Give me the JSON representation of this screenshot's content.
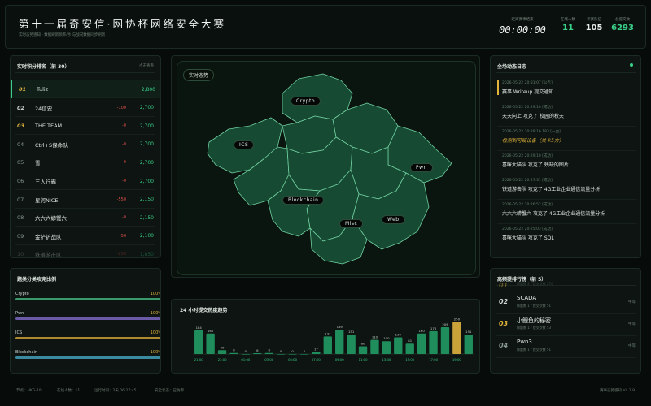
{
  "header": {
    "title": "第十一届奇安信·网协杯网络安全大赛",
    "subtitle": "实时态势感知 · 数据刷新频率/秒 与战况数据同步刷新",
    "countdown_label": "距离赛事结束",
    "countdown": "00:00:00",
    "stats": [
      {
        "label": "在线人数",
        "value": "11",
        "color": "#3ad08a"
      },
      {
        "label": "参赛队伍",
        "value": "105",
        "color": "#e6eee9"
      },
      {
        "label": "总提交数",
        "value": "6293",
        "color": "#3ad08a"
      }
    ]
  },
  "ranking": {
    "title": "实时积分排名（前 30）",
    "hint": "点击查看",
    "rows": [
      {
        "rank": "01",
        "name": "Tuliz",
        "delta": "",
        "score": "2,800",
        "rank_color": "#e2b43c"
      },
      {
        "rank": "02",
        "name": "24信安",
        "delta": "-100",
        "score": "2,700",
        "rank_color": "#cfd8d3"
      },
      {
        "rank": "03",
        "name": "THE TEAM",
        "delta": "-0",
        "score": "2,700",
        "rank_color": "#e2b43c"
      },
      {
        "rank": "04",
        "name": "Ctrl+S保命队",
        "delta": "-0",
        "score": "2,700",
        "rank_color": "#8a9890"
      },
      {
        "rank": "05",
        "name": "雪",
        "delta": "-0",
        "score": "2,700",
        "rank_color": "#8a9890"
      },
      {
        "rank": "06",
        "name": "三人行霸",
        "delta": "-0",
        "score": "2,700",
        "rank_color": "#8a9890"
      },
      {
        "rank": "07",
        "name": "星河NICE!",
        "delta": "-550",
        "score": "2,150",
        "rank_color": "#8a9890"
      },
      {
        "rank": "08",
        "name": "六六六蟒蟹六",
        "delta": "-0",
        "score": "2,150",
        "rank_color": "#8a9890"
      },
      {
        "rank": "09",
        "name": "金铲铲战队",
        "delta": "-50",
        "score": "2,100",
        "rank_color": "#8a9890"
      },
      {
        "rank": "10",
        "name": "铁道游击队",
        "delta": "-250",
        "score": "1,850",
        "rank_color": "#8a9890"
      }
    ]
  },
  "map": {
    "title": "实时态势",
    "labels": [
      "Crypto",
      "ICS",
      "Pwn",
      "Blockchain",
      "Misc",
      "Web"
    ]
  },
  "feed": {
    "title": "全场动态日志",
    "items": [
      {
        "time": "2026-05-22 20:31:07 [公告]",
        "text": "赛事 Writeup 提交通知",
        "text_color": "#e4ece7"
      },
      {
        "time": "2026-05-22 20:29:10 [成功]",
        "text": "天天向上 攻克了 校园的秋天",
        "text_color": "#e4ece7"
      },
      {
        "time": "2026-05-22 20:29:16.183 [一血]",
        "text": "检测到可疑设备（关卡5方）",
        "text_color": "#e2b43c"
      },
      {
        "time": "2026-05-22 20:29:10 [成功]",
        "text": "喜咪大喵队 攻克了 残缺的图片",
        "text_color": "#e4ece7"
      },
      {
        "time": "2026-05-22 20:27:31 [成功]",
        "text": "铁道游击队 攻克了 4G工业企业通信流量分析",
        "text_color": "#e4ece7"
      },
      {
        "time": "2026-05-22 20:26:52 [成功]",
        "text": "六六六蟒蟹六 攻克了 4G工业企业通信流量分析",
        "text_color": "#e4ece7"
      },
      {
        "time": "2026-05-22 20:25:03 [成功]",
        "text": "喜咪大喵队 攻克了 SQL",
        "text_color": "#e4ece7"
      }
    ]
  },
  "categories": {
    "title": "题类分类攻克比例",
    "items": [
      {
        "name": "Crypto",
        "pct": "100%",
        "color": "#3a9a6a"
      },
      {
        "name": "Pwn",
        "pct": "100%",
        "color": "#6a5aa8"
      },
      {
        "name": "ICS",
        "pct": "100%",
        "color": "#b08a30"
      },
      {
        "name": "Blockchain",
        "pct": "100%",
        "color": "#3a8aa0"
      }
    ]
  },
  "trend": {
    "title": "24 小时提交热度趋势"
  },
  "chart_data": {
    "type": "bar",
    "values": [
      184,
      160,
      30,
      8,
      0,
      6,
      8,
      0,
      0,
      0,
      17,
      137,
      189,
      151,
      60,
      110,
      100,
      130,
      81,
      160,
      178,
      209,
      250,
      151
    ],
    "highlight_index": 22,
    "x_ticks": [
      "21:00",
      "23:00",
      "01:00",
      "03:00",
      "05:00",
      "07:00",
      "09:00",
      "11:00",
      "13:00",
      "15:00",
      "17:00",
      "19:00"
    ],
    "ylim": [
      0,
      260
    ]
  },
  "challenges": {
    "title": "高频提排行榜（前 5）",
    "items": [
      {
        "rank": "01",
        "name": "",
        "meta": "解题数 2 / 提交次数 270",
        "tag": "",
        "rank_color": "#e2b43c"
      },
      {
        "rank": "02",
        "name": "SCADA",
        "meta": "解题数 1 / 提交次数 51",
        "tag": "中等",
        "rank_color": "#cfd8d3"
      },
      {
        "rank": "03",
        "name": "小鲤鱼的秘密",
        "meta": "解题数 1 / 提交次数 53",
        "tag": "中等",
        "rank_color": "#e2b43c"
      },
      {
        "rank": "04",
        "name": "Pwn3",
        "meta": "解题数 1 / 提交次数 51",
        "tag": "中等",
        "rank_color": "#8a9890"
      }
    ]
  },
  "footer": {
    "items": [
      "节点：HKG-10",
      "在线人数：11",
      "运行时间：2天 06:27:45",
      "安全状态：已防御"
    ],
    "version": "赛事态势感知 V4.2.9"
  }
}
